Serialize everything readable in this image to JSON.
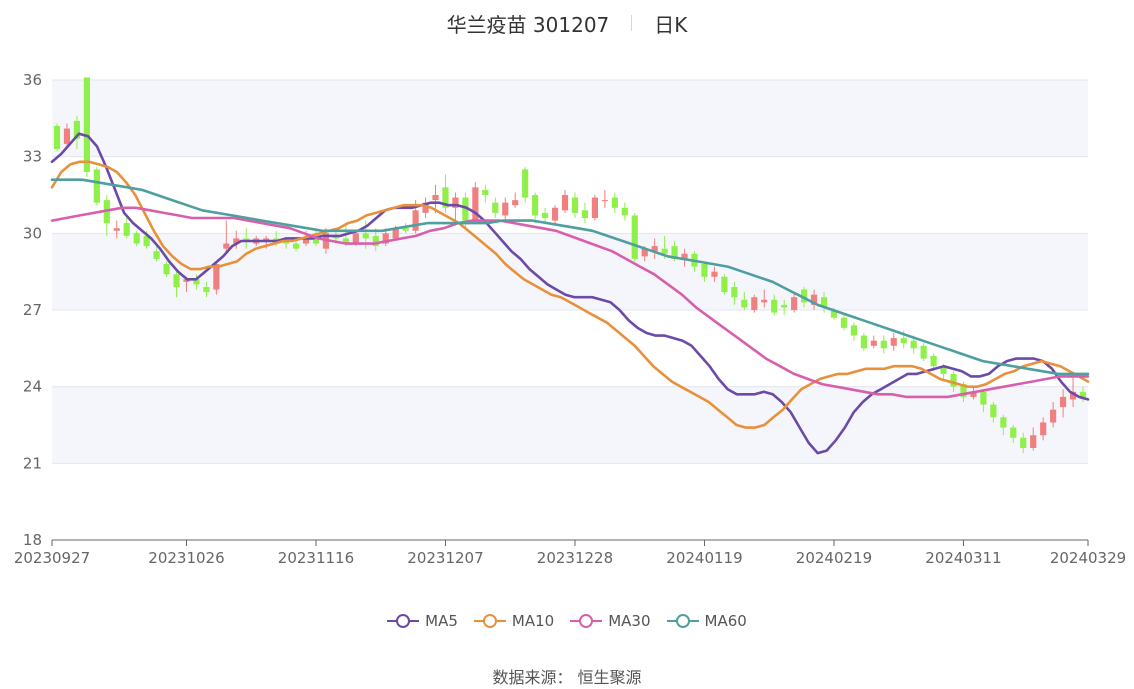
{
  "chart_title": "华兰疫苗 301207",
  "chart_subtitle": "日K",
  "source_label": "数据来源： 恒生聚源",
  "chart_data": {
    "type": "candlestick",
    "title": "华兰疫苗 301207",
    "subtitle": "日K",
    "ylim": [
      18,
      36
    ],
    "yticks": [
      18,
      21,
      24,
      27,
      30,
      33,
      36
    ],
    "xtick_labels": [
      "20230927",
      "20231026",
      "20231116",
      "20231207",
      "20231228",
      "20240119",
      "20240219",
      "20240311",
      "20240329"
    ],
    "xtick_index": [
      0,
      13,
      26,
      39,
      52,
      65,
      78,
      91,
      103
    ],
    "up_color": "#f07f7f",
    "down_color": "#8ff04a",
    "grid": true,
    "legend_position": "bottom",
    "candles": [
      [
        34.2,
        33.3,
        34.3,
        33.2
      ],
      [
        33.5,
        34.1,
        34.3,
        33.3
      ],
      [
        34.4,
        33.7,
        34.6,
        33.3
      ],
      [
        36.1,
        32.4,
        36.1,
        32.2
      ],
      [
        32.5,
        31.2,
        32.6,
        31.1
      ],
      [
        31.3,
        30.4,
        31.5,
        29.9
      ],
      [
        30.1,
        30.2,
        30.5,
        29.8
      ],
      [
        30.4,
        29.9,
        30.6,
        29.8
      ],
      [
        30.0,
        29.6,
        30.1,
        29.5
      ],
      [
        29.9,
        29.5,
        30.1,
        29.4
      ],
      [
        29.3,
        29.0,
        29.5,
        28.9
      ],
      [
        28.8,
        28.4,
        28.9,
        28.3
      ],
      [
        28.4,
        27.9,
        28.5,
        27.5
      ],
      [
        28.1,
        28.2,
        28.3,
        27.7
      ],
      [
        28.2,
        28.0,
        28.4,
        27.8
      ],
      [
        27.9,
        27.7,
        28.1,
        27.5
      ],
      [
        27.8,
        28.8,
        28.9,
        27.6
      ],
      [
        29.4,
        29.6,
        30.5,
        29.2
      ],
      [
        29.6,
        29.8,
        30.1,
        29.4
      ],
      [
        29.8,
        29.7,
        30.2,
        29.4
      ],
      [
        29.6,
        29.8,
        29.9,
        29.5
      ],
      [
        29.7,
        29.8,
        29.9,
        29.4
      ],
      [
        29.8,
        29.6,
        30.1,
        29.5
      ],
      [
        29.7,
        29.6,
        29.8,
        29.4
      ],
      [
        29.6,
        29.4,
        29.7,
        29.3
      ],
      [
        29.6,
        29.8,
        30.1,
        29.5
      ],
      [
        29.8,
        29.6,
        30.2,
        29.5
      ],
      [
        29.4,
        30.0,
        30.2,
        29.2
      ],
      [
        29.9,
        29.8,
        30.1,
        29.6
      ],
      [
        29.8,
        29.6,
        30.4,
        29.5
      ],
      [
        29.6,
        30.0,
        30.1,
        29.5
      ],
      [
        30.0,
        29.8,
        30.5,
        29.4
      ],
      [
        29.9,
        29.5,
        30.2,
        29.3
      ],
      [
        29.6,
        30.0,
        30.2,
        29.5
      ],
      [
        29.8,
        30.2,
        30.3,
        29.7
      ],
      [
        30.2,
        30.1,
        30.4,
        30.0
      ],
      [
        30.1,
        30.9,
        31.3,
        30.0
      ],
      [
        30.8,
        31.2,
        31.4,
        30.6
      ],
      [
        31.3,
        31.5,
        31.9,
        30.8
      ],
      [
        31.8,
        31.0,
        32.3,
        30.8
      ],
      [
        31.0,
        31.4,
        31.6,
        30.3
      ],
      [
        31.4,
        30.5,
        31.6,
        30.2
      ],
      [
        30.5,
        31.8,
        32.0,
        30.4
      ],
      [
        31.7,
        31.5,
        31.9,
        31.2
      ],
      [
        31.2,
        30.8,
        31.4,
        30.6
      ],
      [
        30.7,
        31.2,
        31.4,
        30.5
      ],
      [
        31.1,
        31.3,
        31.6,
        31.0
      ],
      [
        32.5,
        31.4,
        32.6,
        31.2
      ],
      [
        31.5,
        30.7,
        31.6,
        30.4
      ],
      [
        30.8,
        30.6,
        31.0,
        30.4
      ],
      [
        30.5,
        31.0,
        31.1,
        30.3
      ],
      [
        30.9,
        31.5,
        31.7,
        30.8
      ],
      [
        31.4,
        30.8,
        31.6,
        30.6
      ],
      [
        30.9,
        30.6,
        31.2,
        30.4
      ],
      [
        30.6,
        31.4,
        31.5,
        30.5
      ],
      [
        31.3,
        31.3,
        31.7,
        31.0
      ],
      [
        31.4,
        31.0,
        31.6,
        30.8
      ],
      [
        31.0,
        30.7,
        31.2,
        30.5
      ],
      [
        30.7,
        29.0,
        30.8,
        28.9
      ],
      [
        29.1,
        29.4,
        29.5,
        28.9
      ],
      [
        29.3,
        29.5,
        29.8,
        29.0
      ],
      [
        29.4,
        29.2,
        29.9,
        29.0
      ],
      [
        29.5,
        29.0,
        29.7,
        28.9
      ],
      [
        29.0,
        29.2,
        29.4,
        28.7
      ],
      [
        29.2,
        28.7,
        29.3,
        28.5
      ],
      [
        28.8,
        28.3,
        28.9,
        28.1
      ],
      [
        28.3,
        28.5,
        28.7,
        28.1
      ],
      [
        28.3,
        27.7,
        28.4,
        27.6
      ],
      [
        27.9,
        27.5,
        28.1,
        27.2
      ],
      [
        27.4,
        27.1,
        27.7,
        27.0
      ],
      [
        27.0,
        27.5,
        27.6,
        26.9
      ],
      [
        27.3,
        27.4,
        27.8,
        27.1
      ],
      [
        27.4,
        26.9,
        27.6,
        26.8
      ],
      [
        27.2,
        27.1,
        27.4,
        26.8
      ],
      [
        27.0,
        27.5,
        27.7,
        26.9
      ],
      [
        27.8,
        27.3,
        27.9,
        27.1
      ],
      [
        27.2,
        27.6,
        27.8,
        27.0
      ],
      [
        27.5,
        27.1,
        27.7,
        26.9
      ],
      [
        27.0,
        26.7,
        27.1,
        26.6
      ],
      [
        26.7,
        26.3,
        26.8,
        26.2
      ],
      [
        26.4,
        26.0,
        26.5,
        25.8
      ],
      [
        26.0,
        25.5,
        26.1,
        25.4
      ],
      [
        25.6,
        25.8,
        26.0,
        25.5
      ],
      [
        25.8,
        25.5,
        26.0,
        25.3
      ],
      [
        25.6,
        25.9,
        26.1,
        25.4
      ],
      [
        25.9,
        25.7,
        26.2,
        25.5
      ],
      [
        25.8,
        25.5,
        26.0,
        25.3
      ],
      [
        25.6,
        25.1,
        25.7,
        25.0
      ],
      [
        25.2,
        24.8,
        25.3,
        24.6
      ],
      [
        24.8,
        24.5,
        24.9,
        24.3
      ],
      [
        24.5,
        24.0,
        24.6,
        23.8
      ],
      [
        24.1,
        23.6,
        24.2,
        23.4
      ],
      [
        23.6,
        23.8,
        24.0,
        23.5
      ],
      [
        23.8,
        23.3,
        23.9,
        23.0
      ],
      [
        23.3,
        22.8,
        23.4,
        22.6
      ],
      [
        22.8,
        22.4,
        22.9,
        22.1
      ],
      [
        22.4,
        22.0,
        22.5,
        21.8
      ],
      [
        22.0,
        21.6,
        22.2,
        21.4
      ],
      [
        21.6,
        22.1,
        22.4,
        21.5
      ],
      [
        22.1,
        22.6,
        22.8,
        21.9
      ],
      [
        22.6,
        23.1,
        23.4,
        22.4
      ],
      [
        23.2,
        23.6,
        23.9,
        22.8
      ],
      [
        23.5,
        23.8,
        24.4,
        23.2
      ],
      [
        23.8,
        23.6,
        24.0,
        23.4
      ]
    ],
    "series": [
      {
        "name": "MA5",
        "color": "#6b4aa8",
        "values": [
          32.8,
          33.1,
          33.5,
          33.9,
          33.8,
          33.4,
          32.6,
          31.7,
          30.8,
          30.4,
          30.1,
          29.8,
          29.4,
          28.9,
          28.5,
          28.2,
          28.2,
          28.5,
          28.8,
          29.1,
          29.5,
          29.7,
          29.7,
          29.7,
          29.7,
          29.7,
          29.8,
          29.8,
          29.8,
          29.8,
          29.9,
          29.9,
          29.9,
          30.0,
          30.1,
          30.3,
          30.6,
          30.9,
          31.0,
          31.0,
          31.0,
          31.1,
          31.2,
          31.2,
          31.1,
          31.1,
          31.0,
          30.8,
          30.5,
          30.1,
          29.7,
          29.3,
          29.0,
          28.6,
          28.3,
          28.0,
          27.8,
          27.6,
          27.5,
          27.5,
          27.5,
          27.4,
          27.3,
          27.0,
          26.6,
          26.3,
          26.1,
          26.0,
          26.0,
          25.9,
          25.8,
          25.6,
          25.2,
          24.8,
          24.3,
          23.9,
          23.7,
          23.7,
          23.7,
          23.8,
          23.7,
          23.4,
          23.0,
          22.4,
          21.8,
          21.4,
          21.5,
          21.9,
          22.4,
          23.0,
          23.4,
          23.7,
          23.9,
          24.1,
          24.3,
          24.5,
          24.5,
          24.6,
          24.7,
          24.8,
          24.7,
          24.6,
          24.4,
          24.4,
          24.5,
          24.8,
          25.0,
          25.1,
          25.1,
          25.1,
          25.0,
          24.7,
          24.2,
          23.8,
          23.6,
          23.5
        ]
      },
      {
        "name": "MA10",
        "color": "#e8913b",
        "values": [
          31.8,
          32.4,
          32.7,
          32.8,
          32.8,
          32.7,
          32.6,
          32.4,
          32.0,
          31.5,
          30.8,
          30.1,
          29.5,
          29.1,
          28.8,
          28.6,
          28.6,
          28.7,
          28.7,
          28.8,
          28.9,
          29.2,
          29.4,
          29.5,
          29.6,
          29.7,
          29.7,
          29.8,
          29.9,
          30.0,
          30.1,
          30.2,
          30.4,
          30.5,
          30.7,
          30.8,
          30.9,
          31.0,
          31.1,
          31.1,
          31.1,
          31.0,
          30.8,
          30.6,
          30.4,
          30.1,
          29.8,
          29.5,
          29.2,
          28.8,
          28.5,
          28.2,
          28.0,
          27.8,
          27.6,
          27.5,
          27.3,
          27.1,
          26.9,
          26.7,
          26.5,
          26.2,
          25.9,
          25.6,
          25.2,
          24.8,
          24.5,
          24.2,
          24.0,
          23.8,
          23.6,
          23.4,
          23.1,
          22.8,
          22.5,
          22.4,
          22.4,
          22.5,
          22.8,
          23.1,
          23.5,
          23.9,
          24.1,
          24.3,
          24.4,
          24.5,
          24.5,
          24.6,
          24.7,
          24.7,
          24.7,
          24.8,
          24.8,
          24.8,
          24.7,
          24.5,
          24.3,
          24.2,
          24.1,
          24.0,
          24.0,
          24.1,
          24.3,
          24.5,
          24.6,
          24.8,
          24.9,
          25.0,
          24.9,
          24.8,
          24.6,
          24.4,
          24.2
        ]
      },
      {
        "name": "MA30",
        "color": "#d85fad",
        "values": [
          30.5,
          30.6,
          30.7,
          30.8,
          30.9,
          31.0,
          31.0,
          30.9,
          30.8,
          30.7,
          30.6,
          30.6,
          30.6,
          30.6,
          30.5,
          30.4,
          30.3,
          30.2,
          30.0,
          29.8,
          29.7,
          29.6,
          29.6,
          29.6,
          29.7,
          29.8,
          29.9,
          30.1,
          30.2,
          30.4,
          30.5,
          30.5,
          30.5,
          30.4,
          30.3,
          30.2,
          30.1,
          29.9,
          29.7,
          29.5,
          29.3,
          29.0,
          28.7,
          28.4,
          28.0,
          27.6,
          27.1,
          26.7,
          26.3,
          25.9,
          25.5,
          25.1,
          24.8,
          24.5,
          24.3,
          24.1,
          24.0,
          23.9,
          23.8,
          23.7,
          23.7,
          23.6,
          23.6,
          23.6,
          23.6,
          23.7,
          23.8,
          23.9,
          24.0,
          24.1,
          24.2,
          24.3,
          24.4,
          24.4,
          24.4
        ]
      },
      {
        "name": "MA60",
        "color": "#4f9ea0",
        "values": [
          32.1,
          32.1,
          32.1,
          32.0,
          31.9,
          31.8,
          31.7,
          31.5,
          31.3,
          31.1,
          30.9,
          30.8,
          30.7,
          30.6,
          30.5,
          30.4,
          30.3,
          30.2,
          30.1,
          30.1,
          30.1,
          30.1,
          30.1,
          30.2,
          30.3,
          30.4,
          30.4,
          30.4,
          30.4,
          30.4,
          30.5,
          30.5,
          30.5,
          30.4,
          30.3,
          30.2,
          30.1,
          29.9,
          29.7,
          29.5,
          29.3,
          29.1,
          29.0,
          28.9,
          28.8,
          28.7,
          28.5,
          28.3,
          28.1,
          27.8,
          27.5,
          27.2,
          27.0,
          26.8,
          26.6,
          26.4,
          26.2,
          26.0,
          25.8,
          25.6,
          25.4,
          25.2,
          25.0,
          24.9,
          24.8,
          24.7,
          24.6,
          24.5,
          24.5,
          24.5
        ]
      }
    ]
  },
  "legend": [
    {
      "label": "MA5",
      "color": "#6b4aa8"
    },
    {
      "label": "MA10",
      "color": "#e8913b"
    },
    {
      "label": "MA30",
      "color": "#d85fad"
    },
    {
      "label": "MA60",
      "color": "#4f9ea0"
    }
  ]
}
